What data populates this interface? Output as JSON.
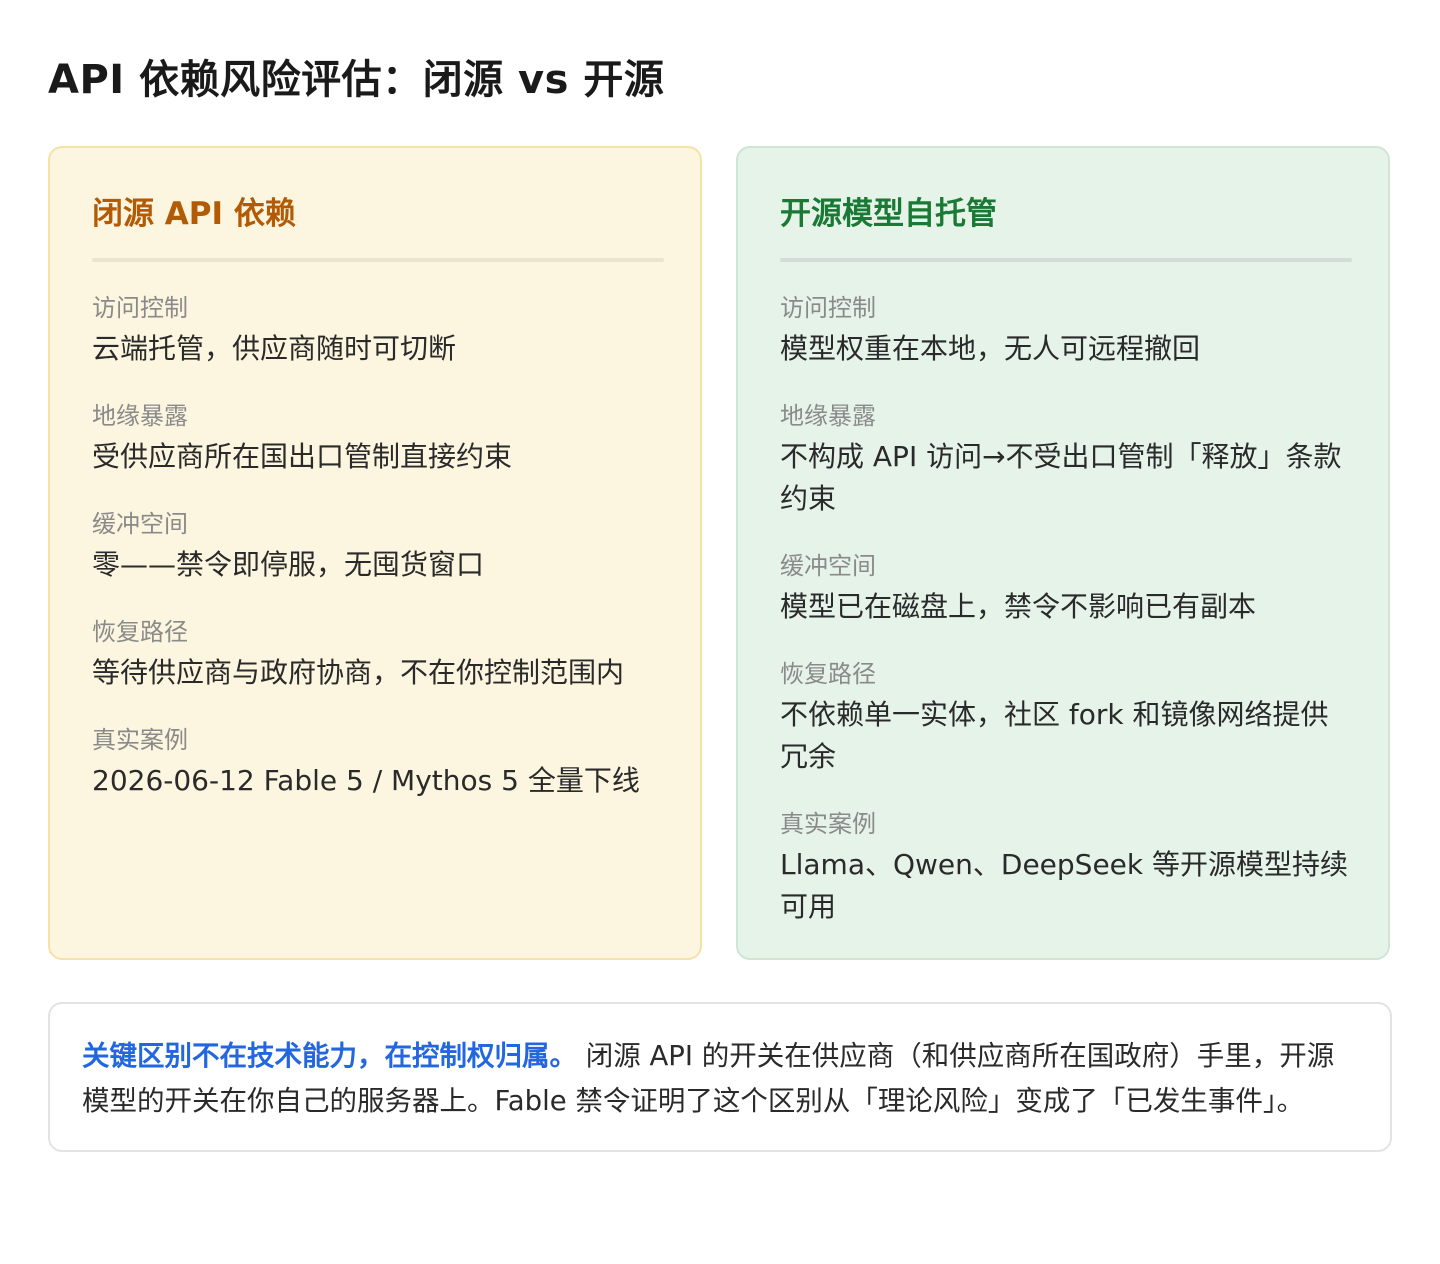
{
  "page": {
    "title": "API 依赖风险评估：闭源 vs 开源"
  },
  "closed_card": {
    "title": "闭源 API 依赖",
    "rows": [
      {
        "label": "访问控制",
        "value": "云端托管，供应商随时可切断"
      },
      {
        "label": "地缘暴露",
        "value": "受供应商所在国出口管制直接约束"
      },
      {
        "label": "缓冲空间",
        "value": "零——禁令即停服，无囤货窗口"
      },
      {
        "label": "恢复路径",
        "value": "等待供应商与政府协商，不在你控制范围内"
      },
      {
        "label": "真实案例",
        "value": "2026-06-12 Fable 5 / Mythos 5 全量下线"
      }
    ]
  },
  "open_card": {
    "title": "开源模型自托管",
    "rows": [
      {
        "label": "访问控制",
        "value": "模型权重在本地，无人可远程撤回"
      },
      {
        "label": "地缘暴露",
        "value": "不构成 API 访问→不受出口管制「释放」条款约束"
      },
      {
        "label": "缓冲空间",
        "value": "模型已在磁盘上，禁令不影响已有副本"
      },
      {
        "label": "恢复路径",
        "value": "不依赖单一实体，社区 fork 和镜像网络提供冗余"
      },
      {
        "label": "真实案例",
        "value": "Llama、Qwen、DeepSeek 等开源模型持续可用"
      }
    ]
  },
  "note": {
    "emphasis": "关键区别不在技术能力，在控制权归属。",
    "body": "闭源 API 的开关在供应商（和供应商所在国政府）手里，开源模型的开关在你自己的服务器上。Fable 禁令证明了这个区别从「理论风险」变成了「已发生事件」。"
  },
  "colors": {
    "closed_accent": "#b35a05",
    "closed_background": "#fcf5df",
    "open_accent": "#1a7a35",
    "open_background": "#e6f3e9",
    "note_emphasis": "#2367e0"
  }
}
